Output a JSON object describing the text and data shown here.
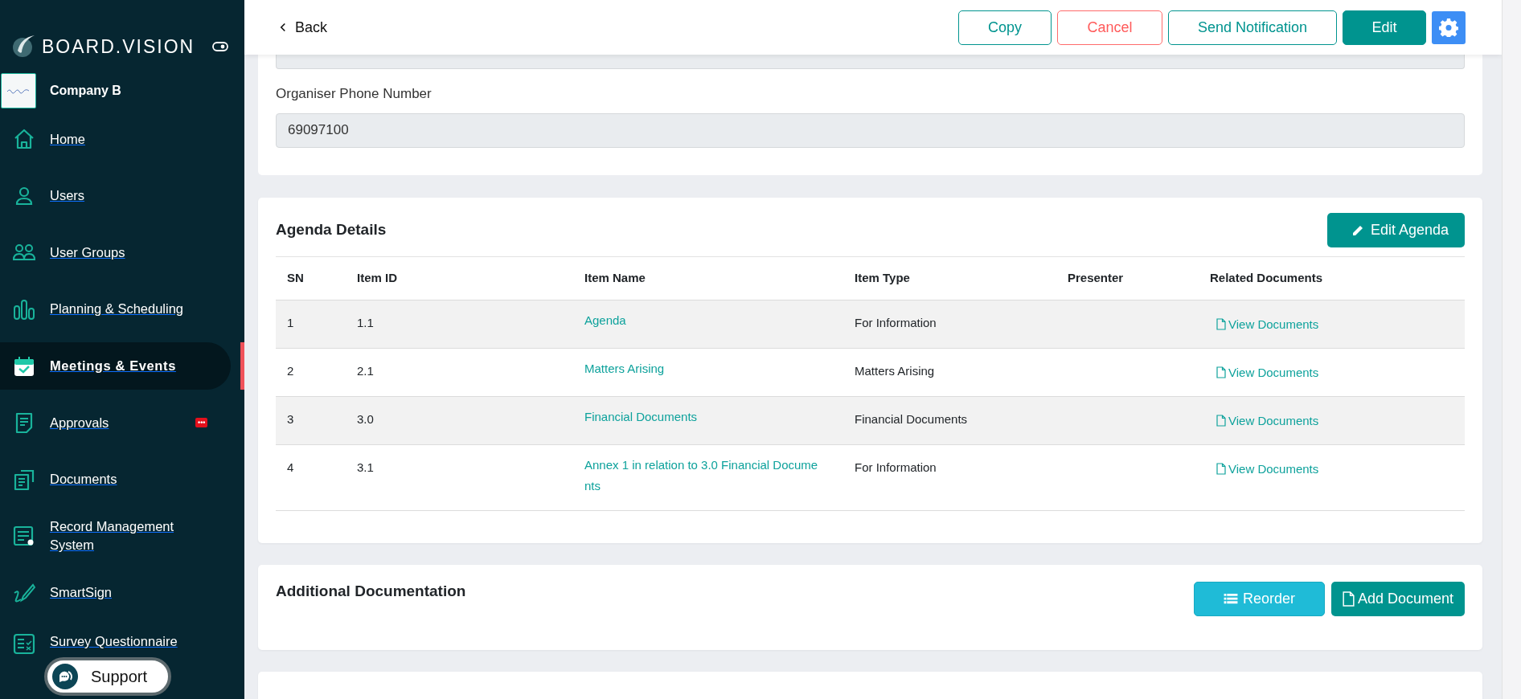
{
  "sidebar": {
    "brand": "BOARD.VISION",
    "company": {
      "name": "Company B"
    },
    "items": [
      {
        "label": "Home",
        "kind": "home",
        "selected": false
      },
      {
        "label": "Users",
        "kind": "user",
        "selected": false
      },
      {
        "label": "User Groups",
        "kind": "users",
        "selected": false
      },
      {
        "label": "Planning & Scheduling",
        "kind": "chart",
        "selected": false
      },
      {
        "label": "Meetings & Events",
        "kind": "calendar",
        "selected": true
      },
      {
        "label": "Approvals",
        "kind": "doc",
        "selected": false,
        "badge": "•••"
      },
      {
        "label": "Documents",
        "kind": "docs",
        "selected": false
      },
      {
        "label": "Record Management System",
        "kind": "record",
        "selected": false
      },
      {
        "label": "SmartSign",
        "kind": "sign",
        "selected": false
      },
      {
        "label": "Survey Questionnaire",
        "kind": "survey",
        "selected": false
      }
    ],
    "support_button": "Support"
  },
  "header": {
    "back": "Back",
    "buttons": [
      {
        "label": "Copy",
        "kind": "outline"
      },
      {
        "label": "Cancel",
        "kind": "danger"
      },
      {
        "label": "Send Notification",
        "kind": "outline"
      },
      {
        "label": "Edit",
        "kind": "primary"
      }
    ]
  },
  "organiser": {
    "label": "Organiser Phone Number",
    "value": "69097100"
  },
  "agenda": {
    "title": "Agenda Details",
    "edit_button": "Edit Agenda",
    "columns": [
      "SN",
      "Item ID",
      "Item Name",
      "Item Type",
      "Presenter",
      "Related Documents"
    ],
    "rows": [
      {
        "sn": "1",
        "item_id": "1.1",
        "item_name": "Agenda",
        "item_type": "For Information",
        "documents": "View Documents"
      },
      {
        "sn": "2",
        "item_id": "2.1",
        "item_name": "Matters Arising",
        "item_type": "Matters Arising",
        "documents": "View Documents"
      },
      {
        "sn": "3",
        "item_id": "3.0",
        "item_name": "Financial Documents",
        "item_type": "Financial Documents",
        "documents": "View Documents"
      },
      {
        "sn": "4",
        "item_id": "3.1",
        "item_name": "Annex 1 in relation to 3.0 Financial Docume nts",
        "item_type": "For Information",
        "documents": "View Documents"
      }
    ]
  },
  "additional": {
    "title": "Additional Documentation",
    "reorder_button": "Reorder",
    "add_button": "Add Document"
  }
}
